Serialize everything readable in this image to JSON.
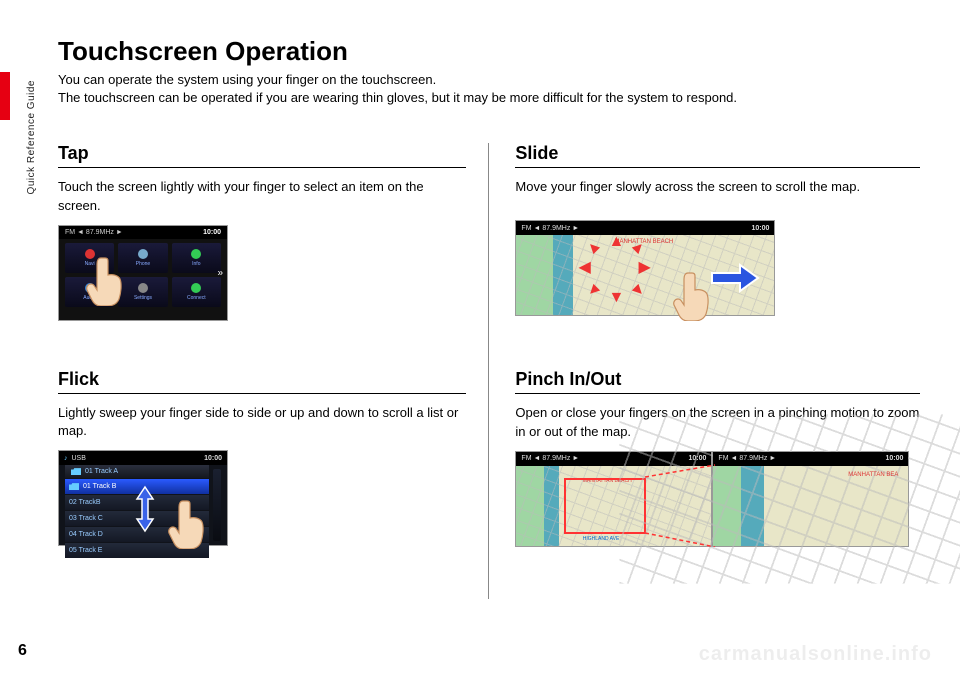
{
  "sidebar": {
    "label": "Quick Reference Guide"
  },
  "page_number": "6",
  "title": "Touchscreen Operation",
  "intro": {
    "line1": "You can operate the system using your finger on the touchscreen.",
    "line2": "The touchscreen can be operated if you are wearing thin gloves, but it may be more difficult for the system to respond."
  },
  "sections": {
    "tap": {
      "heading": "Tap",
      "desc": "Touch the screen lightly with your finger to select an item on the screen.",
      "shot": {
        "band_left": "FM ◄ 87.9MHz ►",
        "time": "10:00",
        "cells": [
          "Navi",
          "Phone",
          "Info",
          "Audio",
          "Settings",
          "Connect"
        ]
      }
    },
    "slide": {
      "heading": "Slide",
      "desc": "Move your finger slowly across the screen to scroll the map.",
      "shot": {
        "band_left": "FM ◄ 87.9MHz ►",
        "time": "10:00",
        "label": "MANHATTAN BEACH"
      }
    },
    "flick": {
      "heading": "Flick",
      "desc": "Lightly sweep your finger side to side or up and down to scroll a list or map.",
      "shot": {
        "source": "USB",
        "time": "10:00",
        "rows": [
          "01  Track A",
          "01  Track B",
          "02  TrackB",
          "03  Track C",
          "04  Track D",
          "05  Track E"
        ]
      }
    },
    "pinch": {
      "heading": "Pinch In/Out",
      "desc": "Open or close your fingers on the screen in a pinching motion to zoom in or out of the map.",
      "shot": {
        "band_left": "FM ◄ 87.9MHz ►",
        "time": "10:00",
        "label_small": "MANHATTAN BEACH",
        "label_big": "MANHATTAN BEA",
        "street": "HIGHLAND AVE"
      }
    }
  },
  "watermark": "carmanualsonline.info"
}
